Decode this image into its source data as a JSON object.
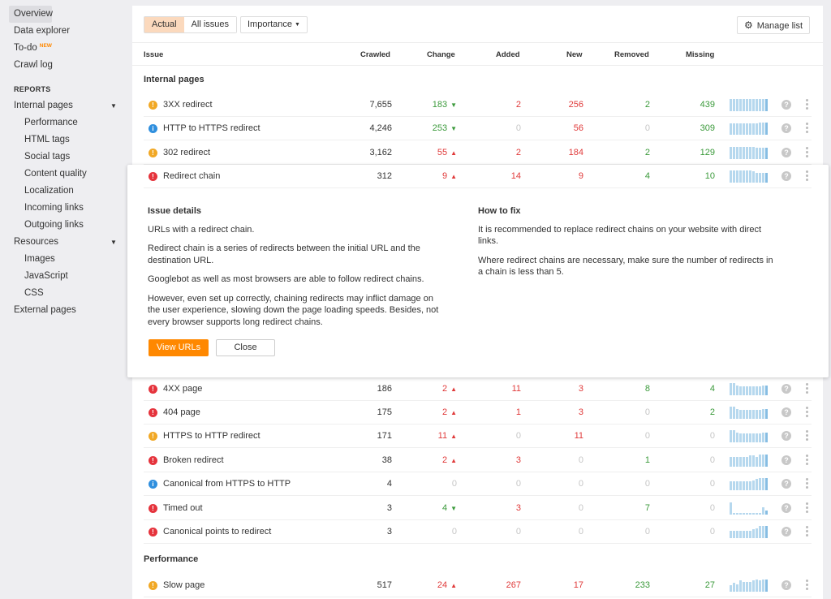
{
  "sidebar": {
    "top_items": [
      {
        "label": "Overview",
        "active": true
      },
      {
        "label": "Data explorer"
      },
      {
        "label": "To-do",
        "badge": "NEW"
      },
      {
        "label": "Crawl log"
      }
    ],
    "reports_heading": "REPORTS",
    "internal_pages": {
      "label": "Internal pages",
      "caret": "▼",
      "children": [
        "Performance",
        "HTML tags",
        "Social tags",
        "Content quality",
        "Localization",
        "Incoming links",
        "Outgoing links"
      ]
    },
    "resources": {
      "label": "Resources",
      "caret": "▼",
      "children": [
        "Images",
        "JavaScript",
        "CSS"
      ]
    },
    "external_pages": "External pages"
  },
  "toolbar": {
    "filter_actual": "Actual",
    "filter_all": "All issues",
    "importance": "Importance",
    "importance_caret": "▼",
    "manage_list": "Manage list",
    "gear_glyph": "⚙"
  },
  "table": {
    "headers": {
      "issue": "Issue",
      "crawled": "Crawled",
      "change": "Change",
      "added": "Added",
      "new": "New",
      "removed": "Removed",
      "missing": "Missing"
    },
    "sections": [
      {
        "title": "Internal pages",
        "rows": [
          {
            "severity": "warning",
            "name": "3XX redirect",
            "crawled": "7,655",
            "change": "183",
            "change_dir": "down",
            "added": "2",
            "new": "256",
            "removed": "2",
            "missing": "439",
            "trend": [
              10,
              10,
              10,
              10,
              10,
              10,
              10,
              10,
              10,
              10,
              10,
              10
            ]
          },
          {
            "severity": "notice",
            "name": "HTTP to HTTPS redirect",
            "crawled": "4,246",
            "change": "253",
            "change_dir": "down",
            "added": "0",
            "new": "56",
            "removed": "0",
            "missing": "309",
            "trend": [
              9,
              9,
              9,
              9,
              9,
              9,
              9,
              9,
              9,
              10,
              10,
              10
            ]
          },
          {
            "severity": "warning",
            "name": "302 redirect",
            "crawled": "3,162",
            "change": "55",
            "change_dir": "up",
            "added": "2",
            "new": "184",
            "removed": "2",
            "missing": "129",
            "trend": [
              10,
              10,
              10,
              10,
              10,
              10,
              10,
              10,
              9,
              9,
              9,
              9
            ]
          },
          {
            "severity": "error",
            "name": "Redirect chain",
            "crawled": "312",
            "change": "9",
            "change_dir": "up",
            "added": "14",
            "new": "9",
            "removed": "4",
            "missing": "10",
            "trend": [
              10,
              10,
              10,
              10,
              10,
              10,
              10,
              9,
              8,
              8,
              8,
              8
            ],
            "expanded": true
          },
          {
            "severity": "error",
            "name": "4XX page",
            "crawled": "186",
            "change": "2",
            "change_dir": "up",
            "added": "11",
            "new": "3",
            "removed": "8",
            "missing": "4",
            "trend": [
              10,
              10,
              8,
              7,
              7,
              7,
              7,
              7,
              7,
              7,
              8,
              8
            ]
          },
          {
            "severity": "error",
            "name": "404 page",
            "crawled": "175",
            "change": "2",
            "change_dir": "up",
            "added": "1",
            "new": "3",
            "removed": "0",
            "missing": "2",
            "trend": [
              10,
              10,
              8,
              7,
              7,
              7,
              7,
              7,
              7,
              7,
              8,
              8
            ]
          },
          {
            "severity": "warning",
            "name": "HTTPS to HTTP redirect",
            "crawled": "171",
            "change": "11",
            "change_dir": "up",
            "added": "0",
            "new": "11",
            "removed": "0",
            "missing": "0",
            "trend": [
              10,
              10,
              8,
              7,
              7,
              7,
              7,
              7,
              7,
              7,
              8,
              8
            ]
          },
          {
            "severity": "error",
            "name": "Broken redirect",
            "crawled": "38",
            "change": "2",
            "change_dir": "up",
            "added": "3",
            "new": "0",
            "removed": "1",
            "missing": "0",
            "trend": [
              8,
              8,
              8,
              8,
              8,
              8,
              9,
              9,
              8,
              10,
              10,
              10
            ]
          },
          {
            "severity": "notice",
            "name": "Canonical from HTTPS to HTTP",
            "crawled": "4",
            "change": "0",
            "change_dir": "none",
            "added": "0",
            "new": "0",
            "removed": "0",
            "missing": "0",
            "trend": [
              7,
              7,
              7,
              7,
              7,
              7,
              7,
              8,
              9,
              10,
              10,
              10
            ]
          },
          {
            "severity": "error",
            "name": "Timed out",
            "crawled": "3",
            "change": "4",
            "change_dir": "down",
            "added": "3",
            "new": "0",
            "removed": "7",
            "missing": "0",
            "trend": [
              10,
              1,
              1,
              1,
              1,
              1,
              1,
              1,
              1,
              1,
              6,
              3
            ]
          },
          {
            "severity": "error",
            "name": "Canonical points to redirect",
            "crawled": "3",
            "change": "0",
            "change_dir": "none",
            "added": "0",
            "new": "0",
            "removed": "0",
            "missing": "0",
            "trend": [
              6,
              6,
              6,
              6,
              6,
              6,
              6,
              7,
              8,
              10,
              10,
              10
            ]
          }
        ]
      },
      {
        "title": "Performance",
        "rows": [
          {
            "severity": "warning",
            "name": "Slow page",
            "crawled": "517",
            "change": "24",
            "change_dir": "up",
            "added": "267",
            "new": "17",
            "removed": "233",
            "missing": "27",
            "trend": [
              5,
              7,
              6,
              9,
              8,
              8,
              8,
              9,
              10,
              9,
              10,
              10
            ]
          }
        ]
      }
    ]
  },
  "detail": {
    "issue_heading": "Issue details",
    "issue_paragraphs": [
      "URLs with a redirect chain.",
      "Redirect chain is a series of redirects between the initial URL and the destination URL.",
      "Googlebot as well as most browsers are able to follow redirect chains.",
      "However, even set up correctly, chaining redirects may inflict damage on the user experience, slowing down the page loading speeds. Besides, not every browser supports long redirect chains."
    ],
    "fix_heading": "How to fix",
    "fix_paragraphs": [
      "It is recommended to replace redirect chains on your website with direct links.",
      "Where redirect chains are necessary, make sure the number of redirects in a chain is less than 5."
    ],
    "view_urls": "View URLs",
    "close": "Close"
  },
  "colors": {
    "accent": "#ff8800",
    "selected_filter": "#fbd9bd",
    "error": "#e5333c",
    "warning": "#f1a825",
    "notice": "#2f8fde",
    "increase": "#e03a3a",
    "decrease": "#3b9a3b",
    "sparkline": "#b6d8ee"
  }
}
